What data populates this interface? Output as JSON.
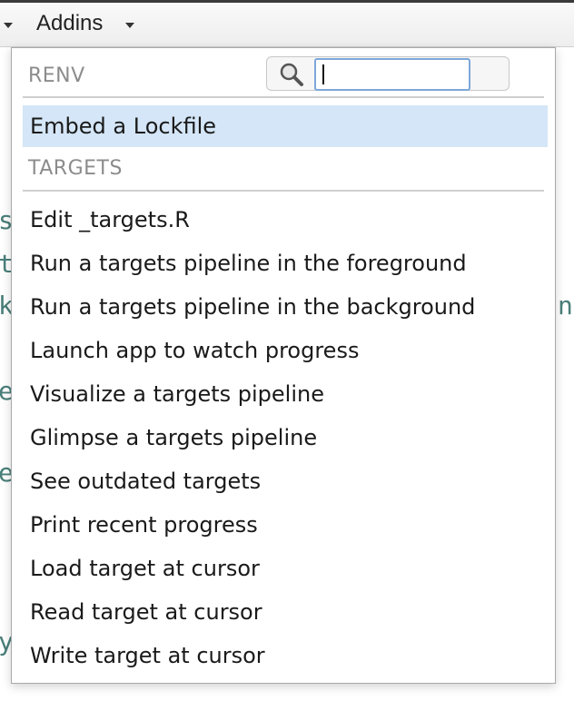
{
  "toolbar": {
    "addins_label": "Addins"
  },
  "background_fragments": {
    "left": [
      "s",
      "t",
      "k",
      "e",
      "e",
      "y"
    ],
    "right": [
      "n"
    ]
  },
  "menu": {
    "search": {
      "icon": "search-icon",
      "value": "",
      "placeholder": ""
    },
    "sections": [
      {
        "header": "RENV",
        "items": [
          {
            "label": "Embed a Lockfile",
            "selected": true
          }
        ]
      },
      {
        "header": "TARGETS",
        "items": [
          {
            "label": "Edit _targets.R"
          },
          {
            "label": "Run a targets pipeline in the foreground"
          },
          {
            "label": "Run a targets pipeline in the background"
          },
          {
            "label": "Launch app to watch progress"
          },
          {
            "label": "Visualize a targets pipeline"
          },
          {
            "label": "Glimpse a targets pipeline"
          },
          {
            "label": "See outdated targets"
          },
          {
            "label": "Print recent progress"
          },
          {
            "label": "Load target at cursor"
          },
          {
            "label": "Read target at cursor"
          },
          {
            "label": "Write target at cursor"
          }
        ]
      }
    ]
  },
  "colors": {
    "selected_bg": "#d4e6f7",
    "section_header": "#8c8c8c",
    "background_code": "#4a7f7a",
    "focus_ring": "#7da7d9"
  }
}
